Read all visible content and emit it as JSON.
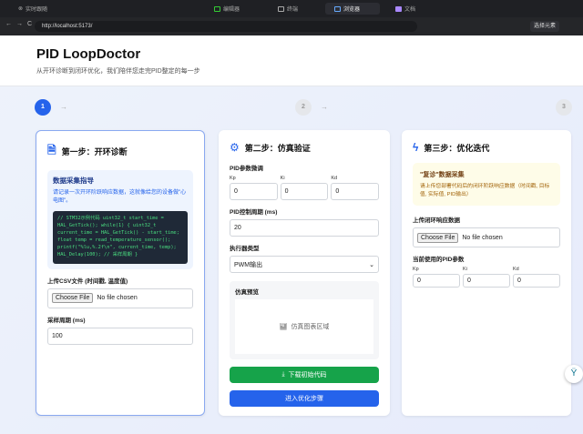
{
  "browser": {
    "follow": "实时跟随",
    "tabs": [
      "编辑器",
      "终端",
      "浏览器",
      "文档"
    ],
    "active_tab": 2,
    "url": "http://localhost:5173/",
    "pick_element": "选择元素"
  },
  "header": {
    "title": "PID LoopDoctor",
    "subtitle": "从开环诊断到闭环优化，我们陪伴您走完PID整定的每一步"
  },
  "steps": [
    "1",
    "2",
    "3"
  ],
  "card1": {
    "title": "第一步：开环诊断",
    "guide_title": "数据采集指导",
    "guide_text": "请记录一次开环阶跃响应数据，这就像给您的设备做\"心电图\"。",
    "code": "// STM32示例代码 uint32_t start_time = HAL_GetTick(); while(1) { uint32_t current_time = HAL_GetTick() - start_time; float temp = read_temperature_sensor(); printf(\"%lu,%.2f\\n\", current_time, temp); HAL_Delay(100); // 采样周期 }",
    "upload_label": "上传CSV文件 (时间戳, 温度值)",
    "choose_file": "Choose File",
    "no_file": "No file chosen",
    "period_label": "采样周期 (ms)",
    "period_value": "100"
  },
  "card2": {
    "title": "第二步：仿真验证",
    "params_label": "PID参数微调",
    "kp_label": "Kp",
    "ki_label": "Ki",
    "kd_label": "Kd",
    "kp": "0",
    "ki": "0",
    "kd": "0",
    "period_label": "PID控制周期 (ms)",
    "period_value": "20",
    "actuator_label": "执行器类型",
    "actuator_value": "PWM输出",
    "preview_label": "仿真预览",
    "chart_placeholder": "仿真图表区域",
    "download_btn": "下载初始代码",
    "next_btn": "进入优化步骤"
  },
  "card3": {
    "title": "第三步：优化迭代",
    "notice_title": "\"复诊\"数据采集",
    "notice_text": "请上传您部署代码后的闭环阶跃响应数据（时间戳, 目标值, 实际值, PID输出）",
    "upload_label": "上传闭环响应数据",
    "choose_file": "Choose File",
    "no_file": "No file chosen",
    "current_label": "当前使用的PID参数",
    "kp_label": "Kp",
    "ki_label": "Ki",
    "kd_label": "Kd",
    "kp": "0",
    "ki": "0",
    "kd": "0"
  }
}
